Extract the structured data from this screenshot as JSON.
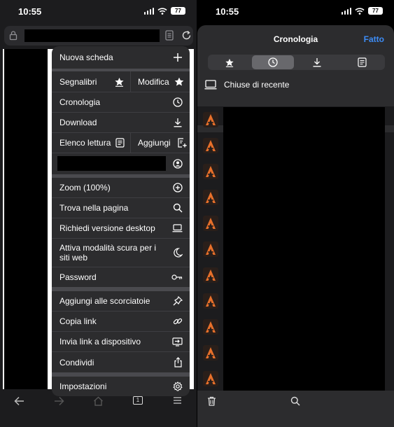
{
  "left": {
    "status": {
      "time": "10:55",
      "battery": "77"
    },
    "tab_count": "1",
    "menu": {
      "new_tab": "Nuova scheda",
      "bookmarks": "Segnalibri",
      "edit": "Modifica",
      "history": "Cronologia",
      "download": "Download",
      "reading_list": "Elenco lettura",
      "add": "Aggiungi",
      "zoom": "Zoom (100%)",
      "find": "Trova nella pagina",
      "desktop": "Richiedi versione desktop",
      "dark_mode": "Attiva modalità scura per i siti web",
      "password": "Password",
      "shortcuts": "Aggiungi alle scorciatoie",
      "copy_link": "Copia link",
      "send_link": "Invia link a dispositivo",
      "share": "Condividi",
      "settings": "Impostazioni"
    }
  },
  "right": {
    "status": {
      "time": "10:55",
      "battery": "77"
    },
    "title": "Cronologia",
    "done": "Fatto",
    "recently_closed": "Chiuse di recente",
    "accent": "#3d8cf5"
  }
}
